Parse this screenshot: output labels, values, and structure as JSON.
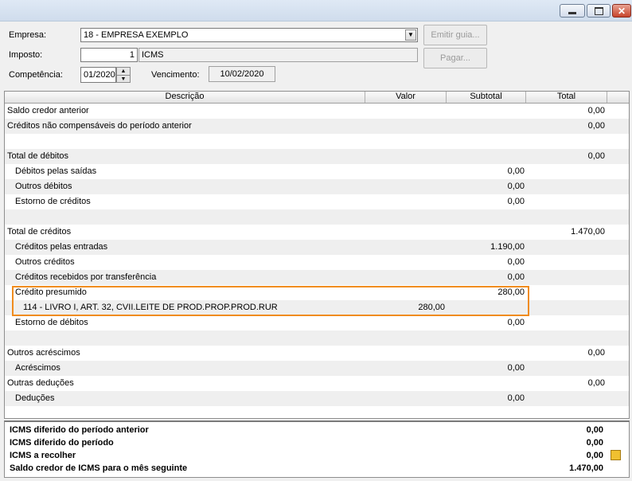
{
  "form": {
    "empresa_label": "Empresa:",
    "empresa_value": "18 - EMPRESA EXEMPLO",
    "imposto_label": "Imposto:",
    "imposto_code": "1",
    "imposto_name": "ICMS",
    "competencia_label": "Competência:",
    "competencia_value": "01/2020",
    "vencimento_label": "Vencimento:",
    "vencimento_value": "10/02/2020"
  },
  "buttons": {
    "emitir_guia": "Emitir guia...",
    "pagar": "Pagar..."
  },
  "columns": [
    "Descrição",
    "Valor",
    "Subtotal",
    "Total"
  ],
  "rows": [
    {
      "label": "Saldo credor anterior",
      "indent": 0,
      "valor": "",
      "subtotal": "",
      "total": "0,00"
    },
    {
      "label": "Créditos não compensáveis do período anterior",
      "indent": 0,
      "valor": "",
      "subtotal": "",
      "total": "0,00"
    },
    {
      "label": "",
      "indent": 0,
      "valor": "",
      "subtotal": "",
      "total": ""
    },
    {
      "label": "Total de débitos",
      "indent": 0,
      "valor": "",
      "subtotal": "",
      "total": "0,00"
    },
    {
      "label": "Débitos pelas saídas",
      "indent": 1,
      "valor": "",
      "subtotal": "0,00",
      "total": ""
    },
    {
      "label": "Outros débitos",
      "indent": 1,
      "valor": "",
      "subtotal": "0,00",
      "total": ""
    },
    {
      "label": "Estorno de créditos",
      "indent": 1,
      "valor": "",
      "subtotal": "0,00",
      "total": ""
    },
    {
      "label": "",
      "indent": 0,
      "valor": "",
      "subtotal": "",
      "total": ""
    },
    {
      "label": "Total de créditos",
      "indent": 0,
      "valor": "",
      "subtotal": "",
      "total": "1.470,00"
    },
    {
      "label": "Créditos pelas entradas",
      "indent": 1,
      "valor": "",
      "subtotal": "1.190,00",
      "total": ""
    },
    {
      "label": "Outros créditos",
      "indent": 1,
      "valor": "",
      "subtotal": "0,00",
      "total": ""
    },
    {
      "label": "Créditos recebidos por transferência",
      "indent": 1,
      "valor": "",
      "subtotal": "0,00",
      "total": ""
    },
    {
      "label": "Crédito presumido",
      "indent": 1,
      "valor": "",
      "subtotal": "280,00",
      "total": ""
    },
    {
      "label": "114 - LIVRO I, ART. 32, CVII.LEITE DE PROD.PROP.PROD.RUR",
      "indent": 2,
      "valor": "280,00",
      "subtotal": "",
      "total": ""
    },
    {
      "label": "Estorno de débitos",
      "indent": 1,
      "valor": "",
      "subtotal": "0,00",
      "total": ""
    },
    {
      "label": "",
      "indent": 0,
      "valor": "",
      "subtotal": "",
      "total": ""
    },
    {
      "label": "Outros acréscimos",
      "indent": 0,
      "valor": "",
      "subtotal": "",
      "total": "0,00"
    },
    {
      "label": "Acréscimos",
      "indent": 1,
      "valor": "",
      "subtotal": "0,00",
      "total": ""
    },
    {
      "label": "Outras deduções",
      "indent": 0,
      "valor": "",
      "subtotal": "",
      "total": "0,00"
    },
    {
      "label": "Deduções",
      "indent": 1,
      "valor": "",
      "subtotal": "0,00",
      "total": ""
    }
  ],
  "summary": [
    {
      "label": "ICMS diferido do período anterior",
      "value": "0,00"
    },
    {
      "label": "ICMS diferido do período",
      "value": "0,00"
    },
    {
      "label": "ICMS a recolher",
      "value": "0,00"
    },
    {
      "label": "Saldo credor de ICMS para o mês seguinte",
      "value": "1.470,00"
    }
  ],
  "icons": {
    "minimize": "minimize-icon",
    "maximize": "maximize-icon",
    "close": "close-icon",
    "calculator": "calculator-icon"
  }
}
